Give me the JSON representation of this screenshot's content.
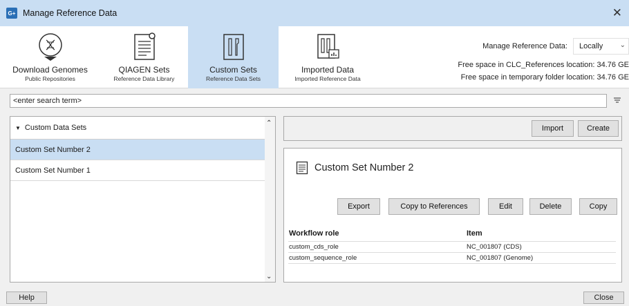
{
  "window": {
    "title": "Manage Reference Data",
    "close_glyph": "✕"
  },
  "toolbar": {
    "tools": [
      {
        "label": "Download Genomes",
        "sub": "Public Repositories",
        "icon": "download-genomes-icon"
      },
      {
        "label": "QIAGEN Sets",
        "sub": "Reference Data Library",
        "icon": "qiagen-sets-icon"
      },
      {
        "label": "Custom Sets",
        "sub": "Reference Data Sets",
        "icon": "custom-sets-icon",
        "active": true
      },
      {
        "label": "Imported Data",
        "sub": "Imported Reference Data",
        "icon": "imported-data-icon"
      }
    ],
    "manage_label": "Manage Reference Data:",
    "manage_value": "Locally",
    "free_space_refs": "Free space in CLC_References location: 34.76 GE",
    "free_space_temp": "Free space in temporary folder location: 34.76 GE"
  },
  "search": {
    "value": "<enter search term>"
  },
  "left_panel": {
    "header": "Custom Data Sets",
    "items": [
      {
        "label": "Custom Set Number 2",
        "selected": true
      },
      {
        "label": "Custom Set Number 1",
        "selected": false
      }
    ]
  },
  "right_top": {
    "import_label": "Import",
    "create_label": "Create"
  },
  "detail": {
    "title": "Custom Set Number 2",
    "buttons": {
      "export": "Export",
      "copy_to_refs": "Copy to References",
      "edit": "Edit",
      "delete": "Delete",
      "copy": "Copy"
    },
    "table": {
      "headers": [
        "Workflow role",
        "Item"
      ],
      "rows": [
        [
          "custom_cds_role",
          "NC_001807 (CDS)"
        ],
        [
          "custom_sequence_role",
          "NC_001807 (Genome)"
        ]
      ]
    }
  },
  "footer": {
    "help_label": "Help",
    "close_label": "Close"
  },
  "colors": {
    "accent": "#c9def3",
    "button_bg": "#e1e1e1"
  }
}
